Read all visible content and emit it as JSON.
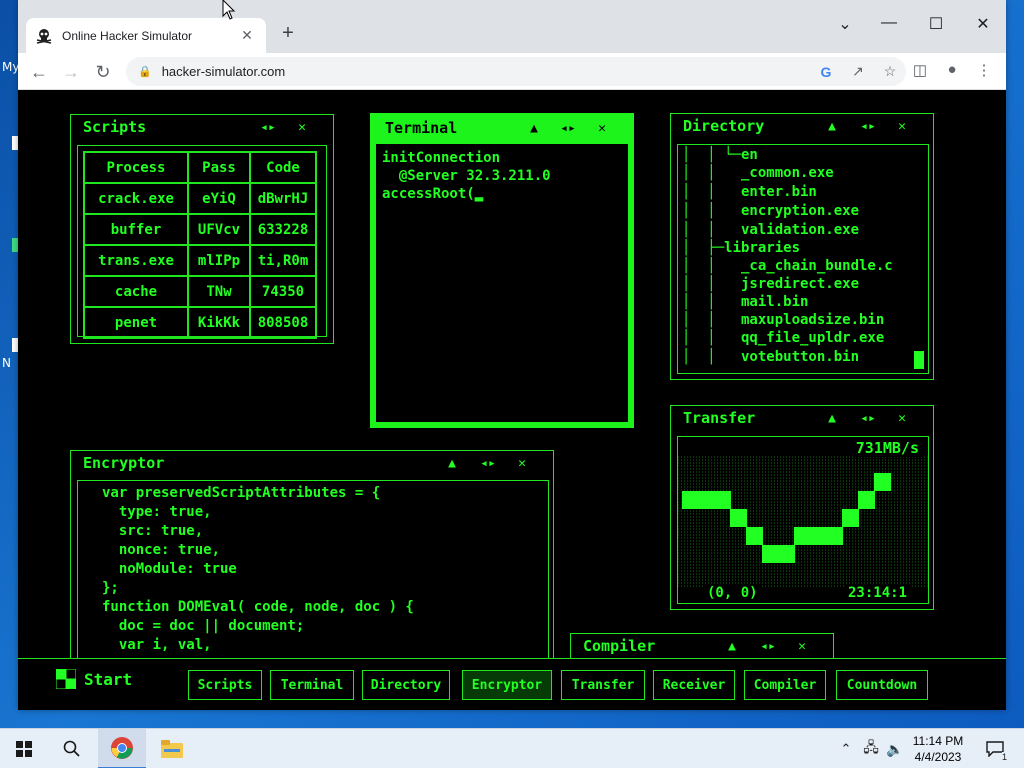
{
  "desktop": {
    "labels": [
      "My",
      "N"
    ]
  },
  "browser": {
    "tab_title": "Online Hacker Simulator",
    "tab_close": "✕",
    "new_tab": "+",
    "url": "hacker-simulator.com",
    "window_controls": {
      "dropdown": "⌄",
      "minimize": "—",
      "maximize": "☐",
      "close": "✕"
    }
  },
  "sim": {
    "scripts": {
      "title": "Scripts",
      "headers": [
        "Process",
        "Pass",
        "Code"
      ],
      "rows": [
        [
          "crack.exe",
          "eYiQ",
          "dBwrHJ"
        ],
        [
          "buffer",
          "UFVcv",
          "633228"
        ],
        [
          "trans.exe",
          "mlIPp",
          "ti,R0m"
        ],
        [
          "cache",
          "TNw",
          "74350"
        ],
        [
          "penet",
          "KikKk",
          "808508"
        ]
      ]
    },
    "terminal": {
      "title": "Terminal",
      "lines": [
        "initConnection",
        "  @Server 32.3.211.0",
        "accessRoot(▂"
      ]
    },
    "directory": {
      "title": "Directory",
      "lines": [
        "│  │ └─en",
        "│  │   _common.exe",
        "│  │   enter.bin",
        "│  │   encryption.exe",
        "│  │   validation.exe",
        "│  ├─libraries",
        "│  │   _ca_chain_bundle.c",
        "│  │   jsredirect.exe",
        "│  │   mail.bin",
        "│  │   maxuploadsize.bin",
        "│  │   qq_file_upldr.exe",
        "│  │   votebutton.bin"
      ]
    },
    "transfer": {
      "title": "Transfer",
      "speed": "731MB/s",
      "coords": "(0, 0)",
      "time": "23:14:1",
      "graph_values": [
        3,
        3,
        3,
        2,
        1,
        0,
        0,
        1,
        1,
        1,
        2,
        3,
        4
      ]
    },
    "encryptor": {
      "title": "Encryptor",
      "lines": [
        "var preservedScriptAttributes = {",
        "  type: true,",
        "  src: true,",
        "  nonce: true,",
        "  noModule: true",
        "};",
        "function DOMEval( code, node, doc ) {",
        "  doc = doc || document;",
        "  var i, val,"
      ]
    },
    "compiler": {
      "title": "Compiler"
    },
    "controls": {
      "up": "▲",
      "resize": "◂▸",
      "close": "✕"
    },
    "start_label": "Start",
    "taskbar_apps": [
      "Scripts",
      "Terminal",
      "Directory",
      "Encryptor",
      "Transfer",
      "Receiver",
      "Compiler",
      "Countdown"
    ]
  },
  "os": {
    "time": "11:14 PM",
    "date": "4/4/2023",
    "notification_count": "1"
  }
}
